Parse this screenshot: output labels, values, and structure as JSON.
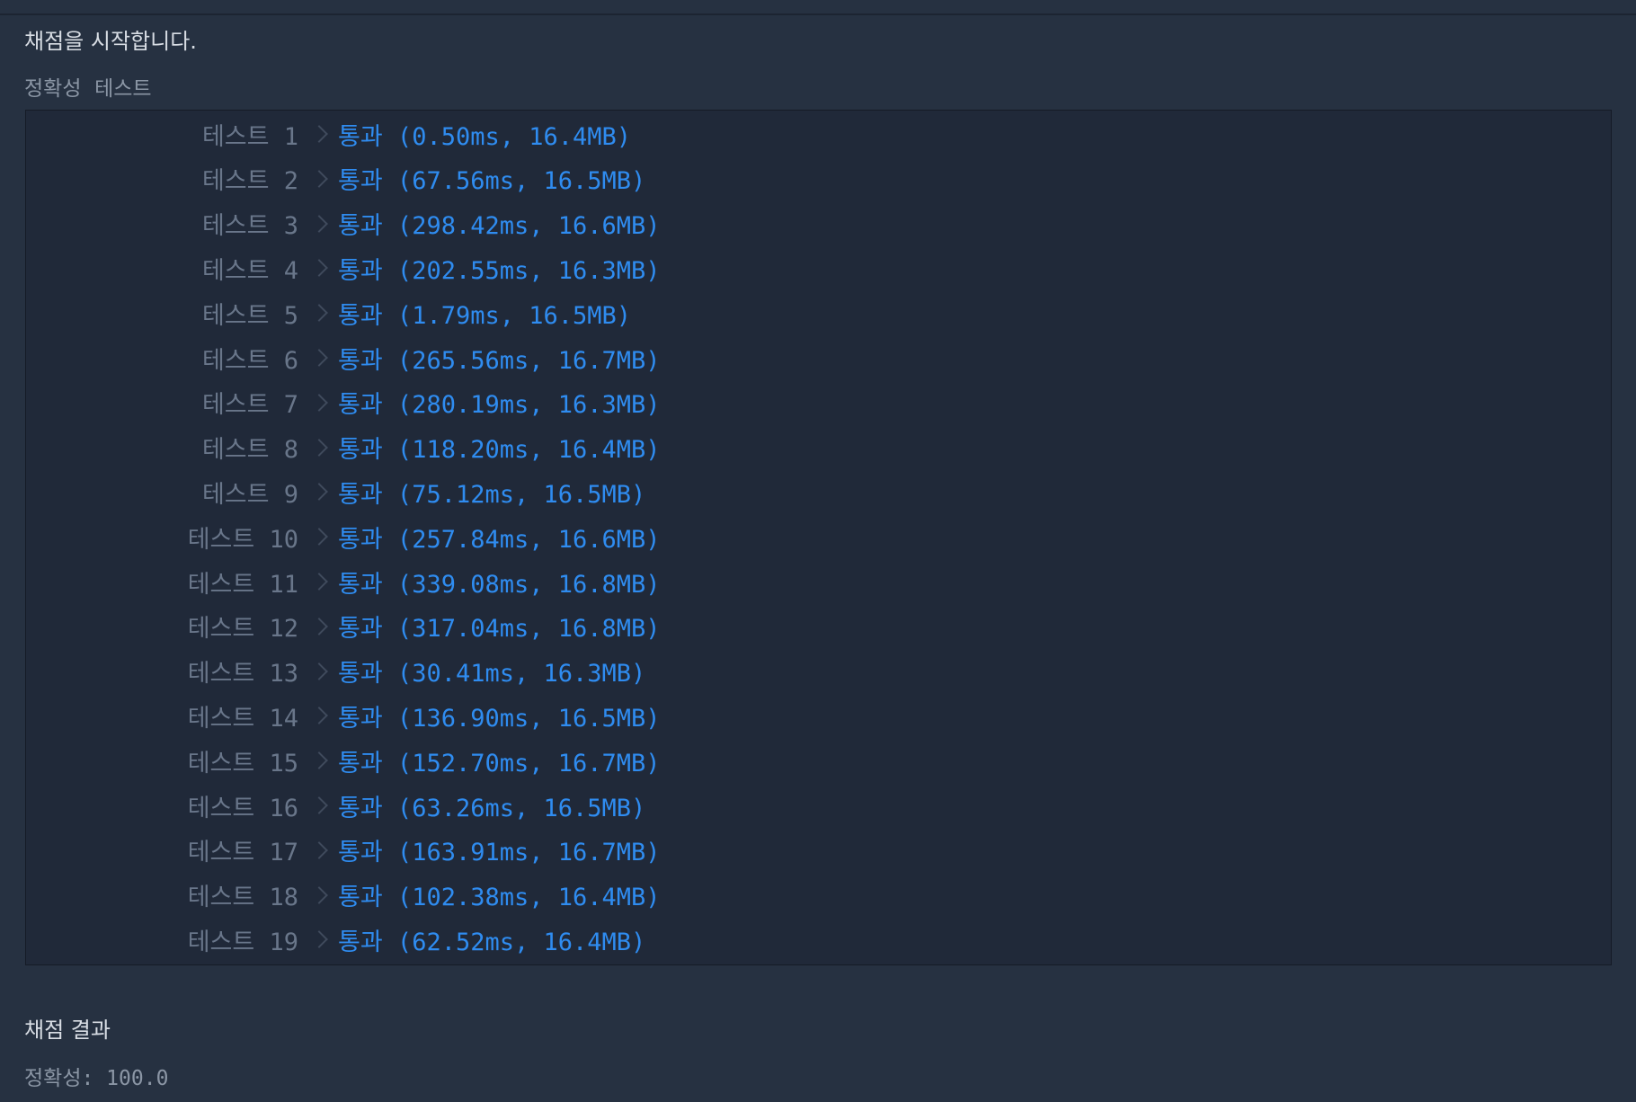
{
  "header": {
    "start_message": "채점을 시작합니다."
  },
  "section": {
    "title": "정확성  테스트"
  },
  "tests": [
    {
      "label": "테스트 1",
      "result": "통과 (0.50ms, 16.4MB)"
    },
    {
      "label": "테스트 2",
      "result": "통과 (67.56ms, 16.5MB)"
    },
    {
      "label": "테스트 3",
      "result": "통과 (298.42ms, 16.6MB)"
    },
    {
      "label": "테스트 4",
      "result": "통과 (202.55ms, 16.3MB)"
    },
    {
      "label": "테스트 5",
      "result": "통과 (1.79ms, 16.5MB)"
    },
    {
      "label": "테스트 6",
      "result": "통과 (265.56ms, 16.7MB)"
    },
    {
      "label": "테스트 7",
      "result": "통과 (280.19ms, 16.3MB)"
    },
    {
      "label": "테스트 8",
      "result": "통과 (118.20ms, 16.4MB)"
    },
    {
      "label": "테스트 9",
      "result": "통과 (75.12ms, 16.5MB)"
    },
    {
      "label": "테스트 10",
      "result": "통과 (257.84ms, 16.6MB)"
    },
    {
      "label": "테스트 11",
      "result": "통과 (339.08ms, 16.8MB)"
    },
    {
      "label": "테스트 12",
      "result": "통과 (317.04ms, 16.8MB)"
    },
    {
      "label": "테스트 13",
      "result": "통과 (30.41ms, 16.3MB)"
    },
    {
      "label": "테스트 14",
      "result": "통과 (136.90ms, 16.5MB)"
    },
    {
      "label": "테스트 15",
      "result": "통과 (152.70ms, 16.7MB)"
    },
    {
      "label": "테스트 16",
      "result": "통과 (63.26ms, 16.5MB)"
    },
    {
      "label": "테스트 17",
      "result": "통과 (163.91ms, 16.7MB)"
    },
    {
      "label": "테스트 18",
      "result": "통과 (102.38ms, 16.4MB)"
    },
    {
      "label": "테스트 19",
      "result": "통과 (62.52ms, 16.4MB)"
    }
  ],
  "grading": {
    "title": "채점 결과",
    "score_text": "정확성: 100.0"
  },
  "colors": {
    "background": "#263141",
    "results_background": "#202939",
    "pass": "#2f8cf0",
    "label": "#69768a"
  },
  "icons": {
    "row_separator": "chevron-right-icon"
  }
}
